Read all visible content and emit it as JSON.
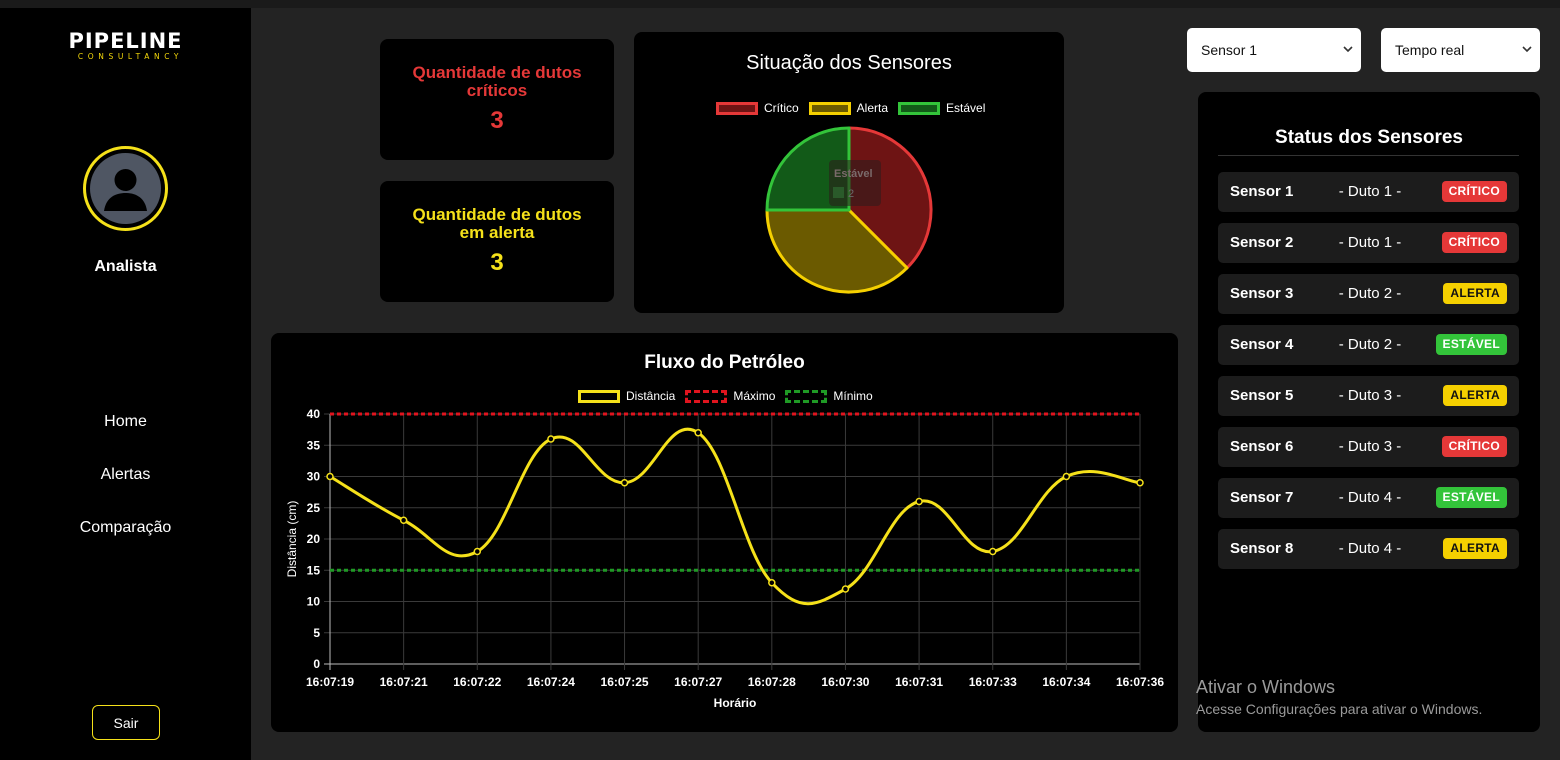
{
  "brand": {
    "name": "PIPELINE",
    "tagline": "CONSULTANCY"
  },
  "user": {
    "role": "Analista"
  },
  "nav": {
    "home": "Home",
    "alerts": "Alertas",
    "compare": "Comparação",
    "logout": "Sair"
  },
  "kpis": {
    "critical": {
      "title": "Quantidade de dutos críticos",
      "value": "3"
    },
    "alert": {
      "title": "Quantidade de dutos em alerta",
      "value": "3"
    }
  },
  "colors": {
    "critical": "#e53838",
    "alert": "#f5e11a",
    "stable": "#33c43a",
    "panel": "#000000",
    "background": "#232323"
  },
  "selects": {
    "sensor": "Sensor 1",
    "period": "Tempo real"
  },
  "status_panel": {
    "title": "Status dos Sensores",
    "rows": [
      {
        "sensor": "Sensor 1",
        "duct": "- Duto 1 -",
        "status": "CRÍTICO",
        "kind": "critico"
      },
      {
        "sensor": "Sensor 2",
        "duct": "- Duto 1 -",
        "status": "CRÍTICO",
        "kind": "critico"
      },
      {
        "sensor": "Sensor 3",
        "duct": "- Duto 2 -",
        "status": "ALERTA",
        "kind": "alerta"
      },
      {
        "sensor": "Sensor 4",
        "duct": "- Duto 2 -",
        "status": "ESTÁVEL",
        "kind": "estavel"
      },
      {
        "sensor": "Sensor 5",
        "duct": "- Duto 3 -",
        "status": "ALERTA",
        "kind": "alerta"
      },
      {
        "sensor": "Sensor 6",
        "duct": "- Duto 3 -",
        "status": "CRÍTICO",
        "kind": "critico"
      },
      {
        "sensor": "Sensor 7",
        "duct": "- Duto 4 -",
        "status": "ESTÁVEL",
        "kind": "estavel"
      },
      {
        "sensor": "Sensor 8",
        "duct": "- Duto 4 -",
        "status": "ALERTA",
        "kind": "alerta"
      }
    ]
  },
  "watermark": {
    "line1": "Ativar o Windows",
    "line2": "Acesse Configurações para ativar o Windows."
  },
  "chart_data": [
    {
      "type": "pie",
      "title": "Situação dos Sensores",
      "legend": "top",
      "labels": [
        "Crítico",
        "Alerta",
        "Estável"
      ],
      "values": [
        3,
        3,
        2
      ],
      "colors": [
        "#e53838",
        "#f5d000",
        "#33c43a"
      ],
      "tooltip": {
        "label": "Estável",
        "value": "2"
      }
    },
    {
      "type": "line",
      "title": "Fluxo do Petróleo",
      "xlabel": "Horário",
      "ylabel": "Distância (cm)",
      "ylim": [
        0,
        40
      ],
      "yticks": [
        "0",
        "5",
        "10",
        "15",
        "20",
        "25",
        "30",
        "35",
        "40"
      ],
      "grid": true,
      "legend": "top",
      "categories": [
        "16:07:19",
        "16:07:21",
        "16:07:22",
        "16:07:24",
        "16:07:25",
        "16:07:27",
        "16:07:28",
        "16:07:30",
        "16:07:31",
        "16:07:33",
        "16:07:34",
        "16:07:36"
      ],
      "series": [
        {
          "name": "Distância",
          "values": [
            30,
            23,
            18,
            36,
            29,
            37,
            13,
            12,
            26,
            18,
            30,
            29
          ],
          "color": "#f5e11a",
          "style": "solid"
        },
        {
          "name": "Máximo",
          "values": [
            40,
            40,
            40,
            40,
            40,
            40,
            40,
            40,
            40,
            40,
            40,
            40
          ],
          "color": "#e0141e",
          "style": "dashed"
        },
        {
          "name": "Mínimo",
          "values": [
            15,
            15,
            15,
            15,
            15,
            15,
            15,
            15,
            15,
            15,
            15,
            15
          ],
          "color": "#1f9a25",
          "style": "dashed"
        }
      ]
    }
  ]
}
